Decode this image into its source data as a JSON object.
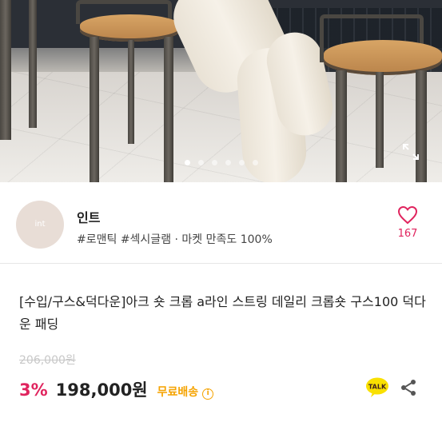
{
  "carousel": {
    "total_dots": 6,
    "active_index": 0
  },
  "seller": {
    "avatar_text": "int",
    "name": "인트",
    "tags": "#로맨틱 #섹시글램 · 마켓 만족도 100%",
    "likes": "167"
  },
  "product": {
    "title": "[수입/구스&덕다운]아크 숏 크롭  a라인 스트링 데일리 크롭숏 구스100 덕다운 패딩",
    "original_price": "206,000원",
    "discount": "3%",
    "price": "198,000원",
    "shipping": "무료배송",
    "info_glyph": "i",
    "talk_label": "TALK"
  },
  "colors": {
    "accent": "#e0245e",
    "shipping": "#f5a300",
    "kakao": "#f9e000"
  },
  "icons": [
    "expand-icon",
    "heart-icon",
    "info-icon",
    "kakao-talk-icon",
    "share-icon"
  ]
}
